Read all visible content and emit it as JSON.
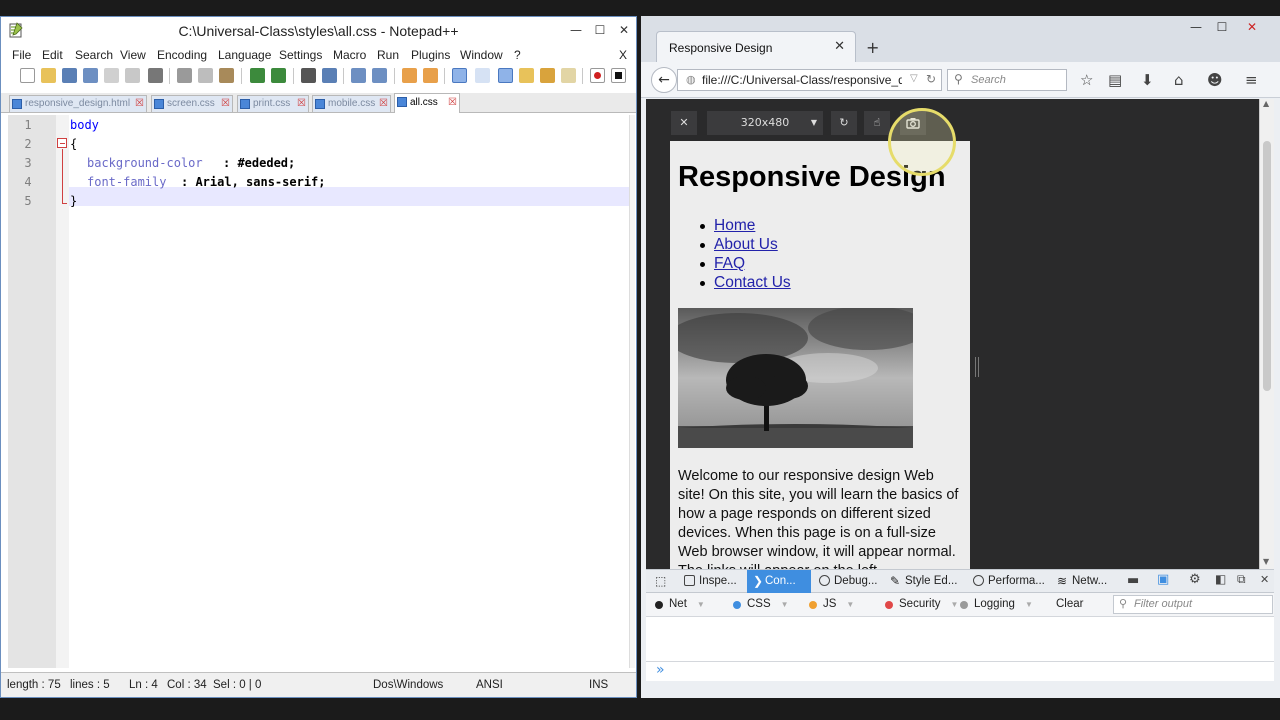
{
  "notepad": {
    "title": "C:\\Universal-Class\\styles\\all.css - Notepad++",
    "window_buttons": {
      "minimize": "—",
      "maximize": "☐",
      "close": "✕"
    },
    "menu": [
      "File",
      "Edit",
      "Search",
      "View",
      "Encoding",
      "Language",
      "Settings",
      "Macro",
      "Run",
      "Plugins",
      "Window",
      "?"
    ],
    "menu_close": "X",
    "tabs": [
      "responsive_design.html",
      "screen.css",
      "print.css",
      "mobile.css",
      "all.css"
    ],
    "active_tab": "all.css",
    "line_numbers": [
      "1",
      "2",
      "3",
      "4",
      "5"
    ],
    "code": {
      "l1": "body",
      "l2": "{",
      "l3_prop": "background-color",
      "l3_rest": ": #ededed;",
      "l4_prop": "font-family",
      "l4_rest": ": Arial, sans-serif;",
      "l5": "}"
    },
    "status": {
      "length": "length : 75",
      "lines": "lines : 5",
      "ln": "Ln : 4",
      "col": "Col : 34",
      "sel": "Sel : 0 | 0",
      "eol": "Dos\\Windows",
      "encoding": "ANSI",
      "mode": "INS"
    }
  },
  "firefox": {
    "tab_title": "Responsive Design",
    "tab_close": "✕",
    "new_tab": "+",
    "url": "file:///C:/Universal-Class/responsive_des",
    "search_placeholder": "Search",
    "window_buttons": {
      "minimize": "—",
      "maximize": "☐",
      "close": "✕"
    },
    "rdm": {
      "close": "✕",
      "size": "320x480",
      "rotate": "↻",
      "touch": "☝",
      "screenshot": "📷"
    },
    "page": {
      "heading": "Responsive Design",
      "nav": [
        "Home",
        "About Us",
        "FAQ",
        "Contact Us"
      ],
      "image_alt": "tree",
      "paragraph": "Welcome to our responsive design Web site! On this site, you will learn the basics of how a page responds on different sized devices. When this page is on a full-size Web browser window, it will appear normal. The links will appear on the left"
    },
    "devtools": {
      "tabs": [
        "Inspe...",
        "Con...",
        "Debug...",
        "Style Ed...",
        "Performa...",
        "Netw..."
      ],
      "selected_tab": "Con...",
      "filters": [
        {
          "label": "Net",
          "color": "#222222"
        },
        {
          "label": "CSS",
          "color": "#3f8ee0"
        },
        {
          "label": "JS",
          "color": "#f0a030"
        },
        {
          "label": "Security",
          "color": "#e04848"
        },
        {
          "label": "Logging",
          "color": "#9a9a9a"
        }
      ],
      "clear": "Clear",
      "filter_placeholder": "Filter output",
      "prompt": "»"
    }
  }
}
